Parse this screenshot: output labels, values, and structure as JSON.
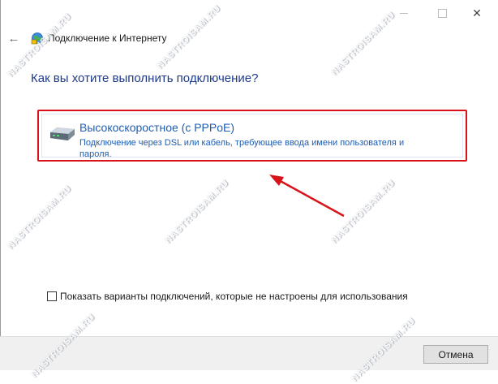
{
  "window": {
    "controls": {
      "minimize_icon": "minimize-icon",
      "maximize_icon": "maximize-icon",
      "close_icon": "close-icon",
      "close_glyph": "✕"
    }
  },
  "nav": {
    "back_icon": "arrow-left-icon",
    "back_glyph": "←",
    "title": "Подключение к Интернету",
    "globe_icon": "network-globe-icon"
  },
  "question": "Как вы хотите выполнить подключение?",
  "option": {
    "icon": "modem-icon",
    "title": "Высокоскоростное (с PPPoE)",
    "description": "Подключение через DSL или кабель, требующее ввода имени пользователя и пароля.",
    "highlight_color": "#d8131a"
  },
  "checkbox": {
    "label": "Показать варианты подключений, которые не настроены для использования",
    "checked": false
  },
  "footer": {
    "cancel_label": "Отмена"
  },
  "watermark": {
    "text": "NASTROISAM.RU"
  },
  "colors": {
    "title_blue": "#1e3a8a",
    "link_blue": "#1e5db4",
    "annotation_red": "#d8131a"
  }
}
